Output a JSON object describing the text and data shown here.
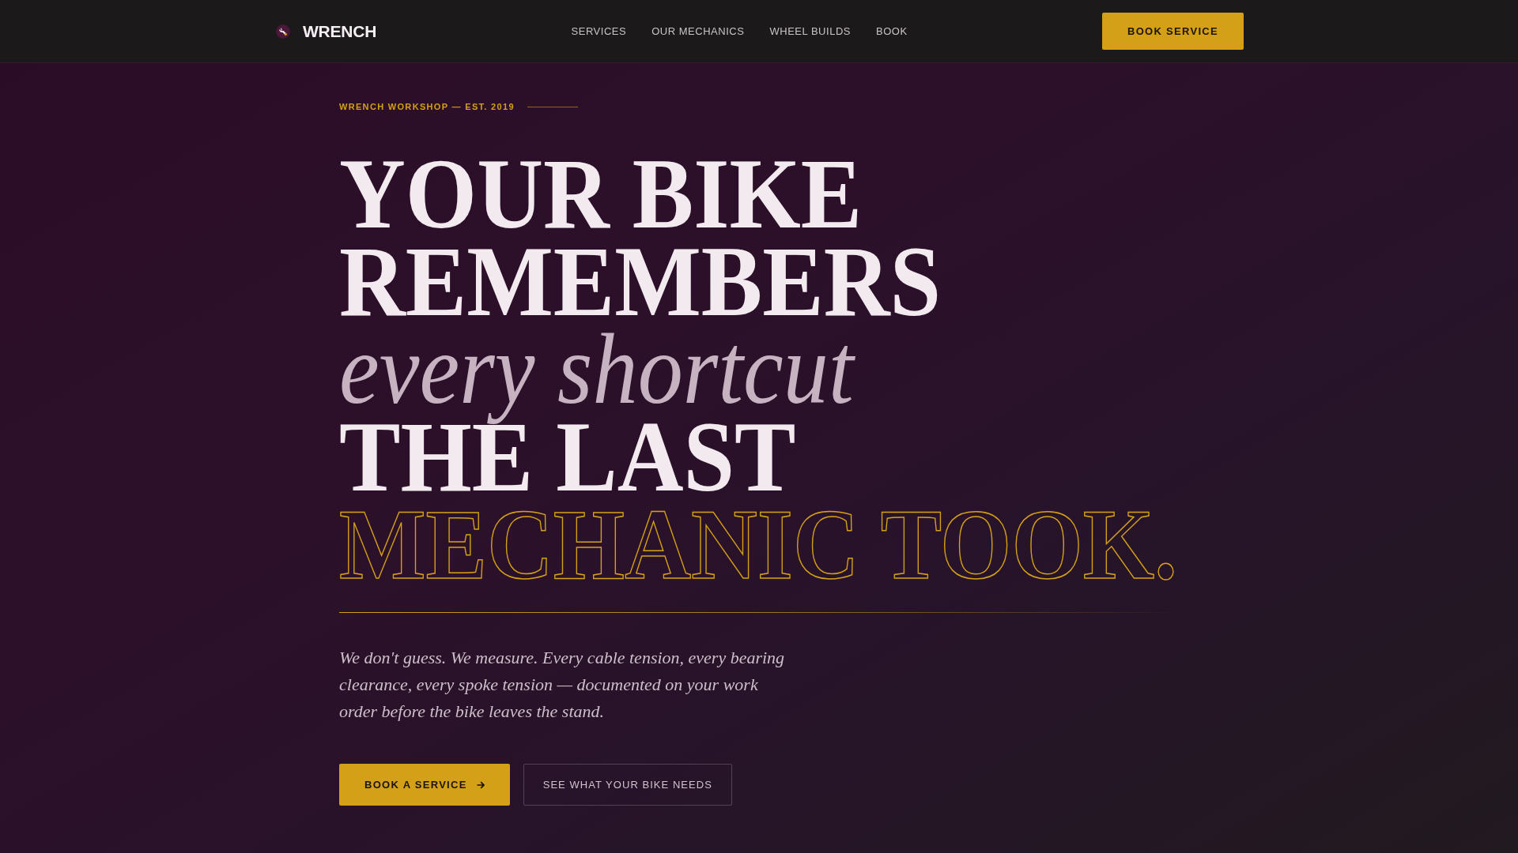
{
  "nav": {
    "brand": "WRENCH",
    "links": [
      {
        "label": "SERVICES"
      },
      {
        "label": "OUR MECHANICS"
      },
      {
        "label": "WHEEL BUILDS"
      },
      {
        "label": "BOOK"
      }
    ],
    "cta": "BOOK SERVICE"
  },
  "hero": {
    "eyebrow": "WRENCH WORKSHOP — EST. 2019",
    "headline": [
      {
        "text": "YOUR BIKE",
        "kind": "solid"
      },
      {
        "text": "REMEMBERS",
        "kind": "solid"
      },
      {
        "text": "every shortcut",
        "kind": "italic"
      },
      {
        "text": "THE LAST",
        "kind": "solid"
      },
      {
        "text": "MECHANIC TOOK.",
        "kind": "outline"
      }
    ],
    "lead": "We don't guess. We measure. Every cable tension, every bearing clearance, every spoke tension — documented on your work order before the bike leaves the stand.",
    "buttons": [
      {
        "label": "BOOK A SERVICE",
        "kind": "primary"
      },
      {
        "label": "SEE WHAT YOUR BIKE NEEDS",
        "kind": "secondary"
      }
    ]
  }
}
